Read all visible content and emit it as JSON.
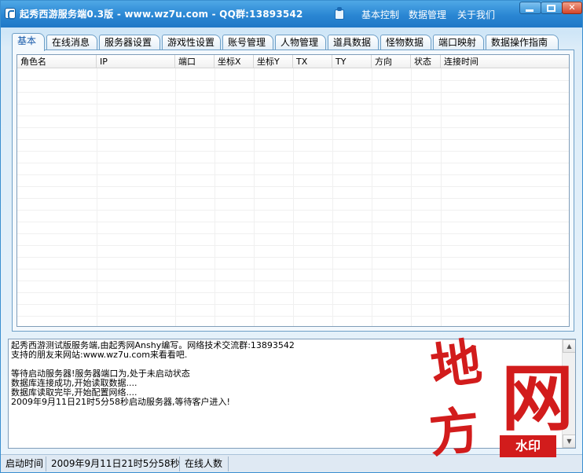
{
  "window": {
    "title": "起秀西游服务端0.3版 - www.wz7u.com - QQ群:13893542",
    "menu": [
      "基本控制",
      "数据管理",
      "关于我们"
    ],
    "close_glyph": "✕"
  },
  "tabs": [
    "基本",
    "在线消息",
    "服务器设置",
    "游戏性设置",
    "账号管理",
    "人物管理",
    "道具数据",
    "怪物数据",
    "端口映射",
    "数据操作指南"
  ],
  "active_tab": "基本",
  "table": {
    "columns": [
      "角色名",
      "IP",
      "端口",
      "坐标X",
      "坐标Y",
      "TX",
      "TY",
      "方向",
      "状态",
      "连接时间"
    ],
    "rows": []
  },
  "log": {
    "lines": [
      "起秀西游测试版服务端,由起秀网Anshy编写。网络技术交流群:13893542",
      "支持的朋友来网站:www.wz7u.com来看看吧.",
      "",
      "等待启动服务器!服务器端口为,处于未启动状态",
      "数据库连接成功,开始读取数据....",
      "数据库读取完毕,开始配置网络....",
      "2009年9月11日21时5分58秒启动服务器,等待客户进入!"
    ]
  },
  "status": {
    "start_label": "启动时间",
    "start_value": "2009年9月11日21时5分58秒",
    "online_label": "在线人数",
    "online_value": ""
  },
  "watermark": {
    "chars": [
      "地",
      "方",
      "网"
    ],
    "badge": "水印"
  },
  "colors": {
    "titlebar": "#2a86d3",
    "watermark": "#d21c1c",
    "active_tab_text": "#1558a8"
  }
}
